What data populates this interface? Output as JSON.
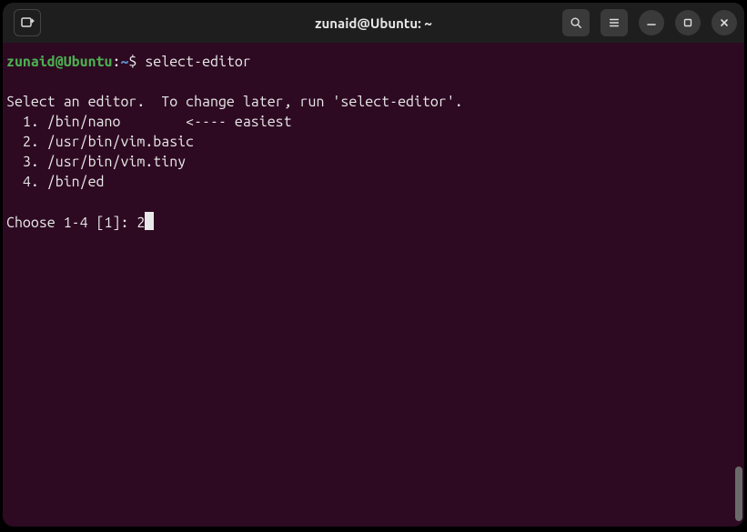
{
  "titlebar": {
    "title": "zunaid@Ubuntu: ~"
  },
  "prompt": {
    "user_host": "zunaid@Ubuntu",
    "colon": ":",
    "path": "~",
    "dollar": "$ ",
    "command": "select-editor"
  },
  "output": {
    "header": "Select an editor.  To change later, run 'select-editor'.",
    "options": [
      "  1. /bin/nano        <---- easiest",
      "  2. /usr/bin/vim.basic",
      "  3. /usr/bin/vim.tiny",
      "  4. /bin/ed"
    ],
    "choose_prompt": "Choose 1-4 [1]: ",
    "input_value": "2"
  }
}
